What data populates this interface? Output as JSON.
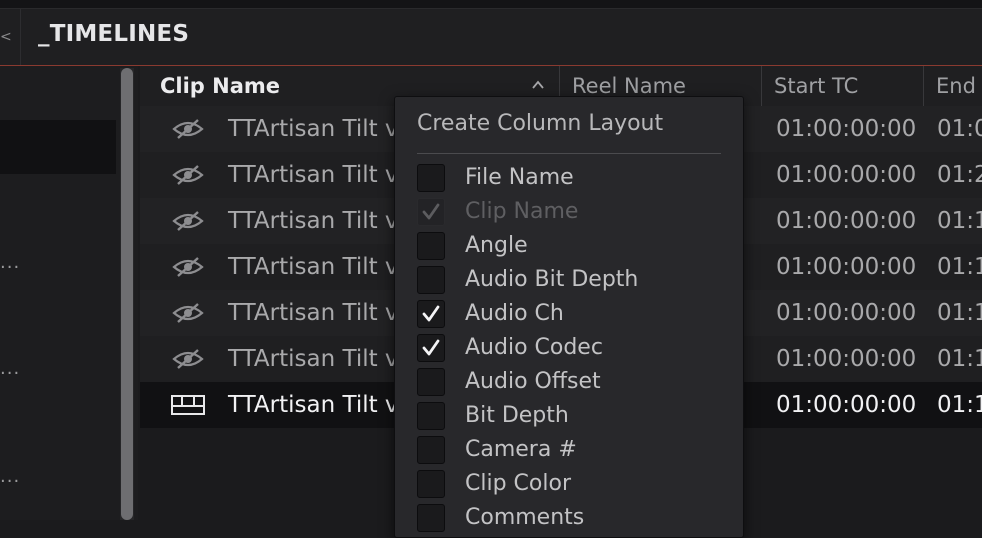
{
  "header": {
    "title": "_TIMELINES",
    "back_glyph": "<"
  },
  "columns": [
    {
      "label": "Clip Name"
    },
    {
      "label": "Reel Name"
    },
    {
      "label": "Start TC"
    },
    {
      "label": "End T"
    }
  ],
  "rows": [
    {
      "clip": "TTArtisan Tilt v",
      "start": "01:00:00:00",
      "end": "01:0",
      "icon": "hidden-eye-icon"
    },
    {
      "clip": "TTArtisan Tilt v",
      "start": "01:00:00:00",
      "end": "01:2",
      "icon": "hidden-eye-icon"
    },
    {
      "clip": "TTArtisan Tilt v",
      "start": "01:00:00:00",
      "end": "01:1",
      "icon": "hidden-eye-icon"
    },
    {
      "clip": "TTArtisan Tilt v",
      "start": "01:00:00:00",
      "end": "01:1",
      "icon": "hidden-eye-icon"
    },
    {
      "clip": "TTArtisan Tilt v",
      "start": "01:00:00:00",
      "end": "01:1",
      "icon": "hidden-eye-icon"
    },
    {
      "clip": "TTArtisan Tilt v",
      "start": "01:00:00:00",
      "end": "01:1",
      "icon": "hidden-eye-icon"
    },
    {
      "clip": "TTArtisan Tilt v",
      "start": "01:00:00:00",
      "end": "01:1",
      "icon": "timeline-icon"
    }
  ],
  "left_panel": {
    "ellipses": [
      "...",
      "...",
      "..."
    ]
  },
  "popup": {
    "title": "Create Column Layout",
    "options": [
      {
        "label": "File Name",
        "checked": false,
        "disabled": false
      },
      {
        "label": "Clip Name",
        "checked": true,
        "disabled": true
      },
      {
        "label": "Angle",
        "checked": false,
        "disabled": false
      },
      {
        "label": "Audio Bit Depth",
        "checked": false,
        "disabled": false
      },
      {
        "label": "Audio Ch",
        "checked": true,
        "disabled": false
      },
      {
        "label": "Audio Codec",
        "checked": true,
        "disabled": false
      },
      {
        "label": "Audio Offset",
        "checked": false,
        "disabled": false
      },
      {
        "label": "Bit Depth",
        "checked": false,
        "disabled": false
      },
      {
        "label": "Camera #",
        "checked": false,
        "disabled": false
      },
      {
        "label": "Clip Color",
        "checked": false,
        "disabled": false
      },
      {
        "label": "Comments",
        "checked": false,
        "disabled": false
      }
    ]
  },
  "colors": {
    "accent_line": "#8a3a30",
    "background": "#1b1b1d",
    "selected_row": "#111113"
  }
}
